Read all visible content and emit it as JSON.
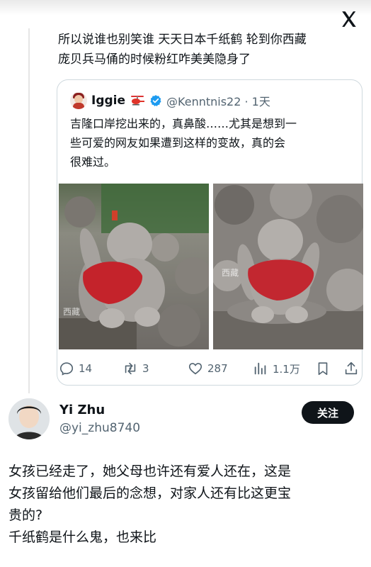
{
  "reply": {
    "lines": [
      "所以说谁也别笑谁 天天日本千纸鹤 轮到你西藏",
      "庞贝兵马俑的时候粉红咋美美隐身了"
    ]
  },
  "quote": {
    "name": "Iggie",
    "handle": "@Kenntnis22 · 1天",
    "text_lines": [
      "吉隆口岸挖出来的，真鼻酸……尤其是想到一",
      "些可爱的网友如果遭到这样的变故，真的会",
      "很难过。"
    ],
    "stats": {
      "replies": "14",
      "retweets": "3",
      "likes": "287",
      "views": "1.1万"
    },
    "photo_watermark": "西藏"
  },
  "user2": {
    "name": "Yi Zhu",
    "handle": "@yi_zhu8740",
    "follow_label": "关注"
  },
  "post": {
    "lines": [
      "女孩已经走了，她父母也许还有爱人还在，这是",
      "女孩留给他们最后的念想，对家人还有比这更宝",
      "贵的?",
      "千纸鹤是什么鬼，也来比"
    ]
  },
  "icons": {
    "x_logo": "x-logo-icon",
    "reply": "reply-icon",
    "retweet": "retweet-icon",
    "like": "heart-icon",
    "views": "views-icon",
    "bookmark": "bookmark-icon",
    "share": "share-icon"
  },
  "colors": {
    "verified": "#1d9bf0",
    "muted": "#536471",
    "text": "#0f1419",
    "follow_bg": "#0f1419"
  }
}
